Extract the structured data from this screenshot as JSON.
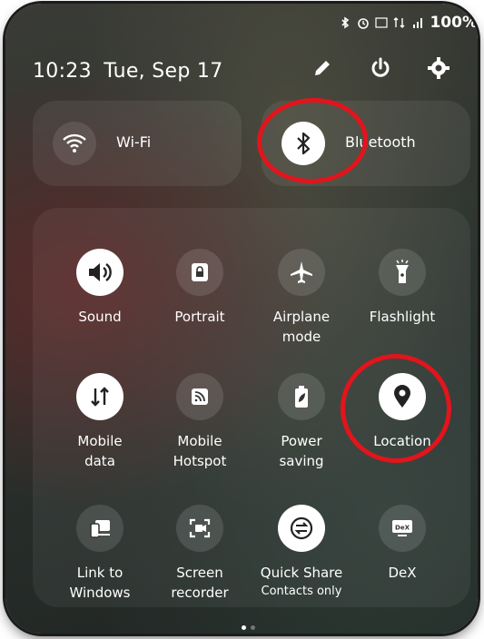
{
  "status_bar": {
    "icons": [
      "bluetooth-icon",
      "alarm-icon",
      "volte-lte-icon",
      "4g-icon",
      "signal-icon"
    ],
    "battery": "100%"
  },
  "header": {
    "time": "10:23",
    "date": "Tue, Sep 17",
    "icons": [
      "edit-pencil-icon",
      "power-icon",
      "settings-gear-icon"
    ]
  },
  "top_tiles": [
    {
      "label": "Wi-Fi",
      "icon": "wifi-icon",
      "state": "off"
    },
    {
      "label": "Bluetooth",
      "icon": "bluetooth-icon",
      "state": "on"
    }
  ],
  "grid_tiles": [
    {
      "label": "Sound",
      "icon": "sound-icon",
      "state": "on"
    },
    {
      "label": "Portrait",
      "icon": "portrait-lock-icon",
      "state": "off"
    },
    {
      "label": "Airplane\nmode",
      "icon": "airplane-icon",
      "state": "off"
    },
    {
      "label": "Flashlight",
      "icon": "flashlight-icon",
      "state": "off"
    },
    {
      "label": "Mobile\ndata",
      "icon": "mobile-data-icon",
      "state": "on"
    },
    {
      "label": "Mobile\nHotspot",
      "icon": "hotspot-icon",
      "state": "off"
    },
    {
      "label": "Power\nsaving",
      "icon": "battery-leaf-icon",
      "state": "off"
    },
    {
      "label": "Location",
      "icon": "location-pin-icon",
      "state": "on"
    },
    {
      "label": "Link to\nWindows",
      "icon": "link-windows-icon",
      "state": "off"
    },
    {
      "label": "Screen\nrecorder",
      "icon": "screen-recorder-icon",
      "state": "off"
    },
    {
      "label": "Quick Share",
      "sublabel": "Contacts only",
      "icon": "quick-share-icon",
      "state": "on"
    },
    {
      "label": "DeX",
      "icon": "dex-icon",
      "state": "off"
    }
  ],
  "page_indicator": {
    "count": 2,
    "active": 1
  },
  "colors": {
    "annotation": "#e2141c",
    "tile_on": "#ffffff",
    "text": "#ffffff"
  }
}
